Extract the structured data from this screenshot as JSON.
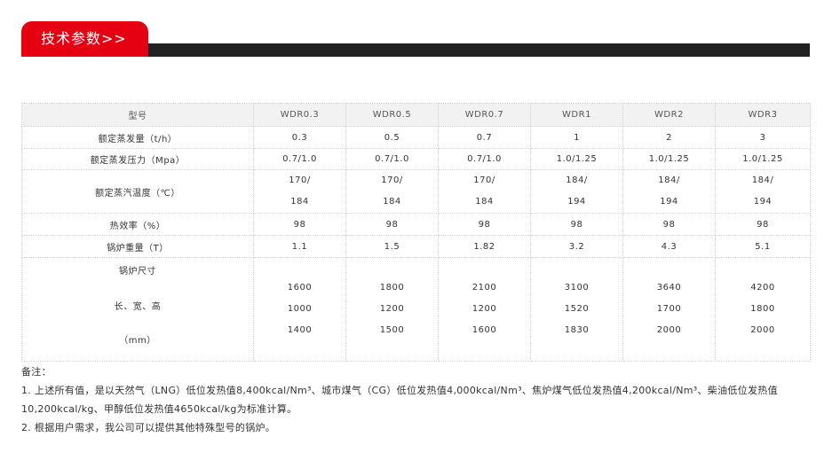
{
  "header": {
    "title": "技术参数>>"
  },
  "table": {
    "columns": [
      "型号",
      "WDR0.3",
      "WDR0.5",
      "WDR0.7",
      "WDR1",
      "WDR2",
      "WDR3"
    ],
    "rows": [
      {
        "label": "额定蒸发量（t/h）",
        "values": [
          "0.3",
          "0.5",
          "0.7",
          "1",
          "2",
          "3"
        ]
      },
      {
        "label": "额定蒸发压力（Mpa）",
        "values": [
          "0.7/1.0",
          "0.7/1.0",
          "0.7/1.0",
          "1.0/1.25",
          "1.0/1.25",
          "1.0/1.25"
        ]
      },
      {
        "label": "额定蒸汽温度（℃）",
        "values": [
          [
            "170/",
            "184"
          ],
          [
            "170/",
            "184"
          ],
          [
            "170/",
            "184"
          ],
          [
            "184/",
            "194"
          ],
          [
            "184/",
            "194"
          ],
          [
            "184/",
            "194"
          ]
        ]
      },
      {
        "label": "热效率（%）",
        "values": [
          "98",
          "98",
          "98",
          "98",
          "98",
          "98"
        ]
      },
      {
        "label": "锅炉重量（T）",
        "values": [
          "1.1",
          "1.5",
          "1.82",
          "3.2",
          "4.3",
          "5.1"
        ]
      }
    ],
    "dimensions": {
      "label_lines": [
        "锅炉尺寸",
        "长、宽、高",
        "（mm）"
      ],
      "values": [
        [
          "1600",
          "1000",
          "1400"
        ],
        [
          "1800",
          "1200",
          "1500"
        ],
        [
          "2100",
          "1200",
          "1600"
        ],
        [
          "3100",
          "1520",
          "1830"
        ],
        [
          "3640",
          "1700",
          "2000"
        ],
        [
          "4200",
          "1800",
          "2000"
        ]
      ]
    }
  },
  "notes": {
    "title": "备注：",
    "items": [
      "1. 上述所有值，是以天然气（LNG）低位发热值8,400kcal/Nm³、城市煤气（CG）低位发热值4,000kcal/Nm³、焦炉煤气低位发热值4,200kcal/Nm³、柴油低位发热值10,200kcal/kg、甲醇低位发热值4650kcal/kg为标准计算。",
      "2. 根据用户需求，我公司可以提供其他特殊型号的锅炉。"
    ]
  },
  "colors": {
    "accent": "#e50012",
    "bar": "#222222",
    "dimension_label": "#1a8dc9"
  }
}
